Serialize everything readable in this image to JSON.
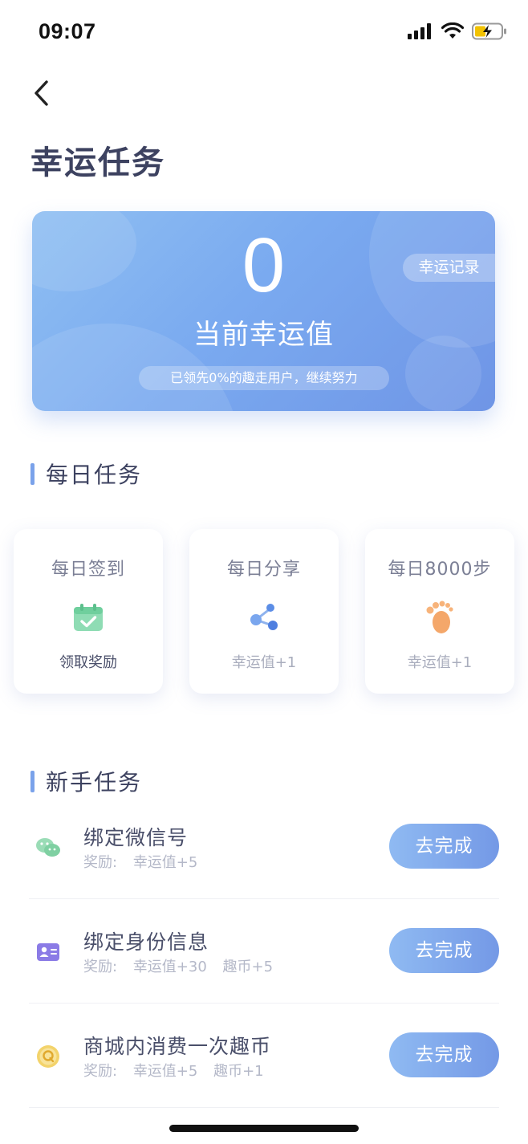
{
  "status_bar": {
    "time": "09:07"
  },
  "header": {
    "title": "幸运任务"
  },
  "luck_card": {
    "value": "0",
    "label": "当前幸运值",
    "record_button": "幸运记录",
    "rank_text": "已领先0%的趣走用户，继续努力"
  },
  "daily": {
    "title": "每日任务",
    "cards": [
      {
        "title": "每日签到",
        "reward": "领取奖励",
        "icon": "calendar-check-icon"
      },
      {
        "title": "每日分享",
        "reward": "幸运值+1",
        "icon": "share-icon"
      },
      {
        "title": "每日8000步",
        "reward": "幸运值+1",
        "icon": "footprint-icon"
      }
    ]
  },
  "newbie": {
    "title": "新手任务",
    "tasks": [
      {
        "title": "绑定微信号",
        "reward_label": "奖励:",
        "rewards": [
          "幸运值+5"
        ],
        "button": "去完成",
        "icon": "wechat-icon"
      },
      {
        "title": "绑定身份信息",
        "reward_label": "奖励:",
        "rewards": [
          "幸运值+30",
          "趣币+5"
        ],
        "button": "去完成",
        "icon": "id-card-icon"
      },
      {
        "title": "商城内消费一次趣币",
        "reward_label": "奖励:",
        "rewards": [
          "幸运值+5",
          "趣币+1"
        ],
        "button": "去完成",
        "icon": "coin-icon"
      }
    ]
  },
  "colors": {
    "accent": "#7aa2ea",
    "card_gradient_start": "#8fbff2",
    "card_gradient_end": "#6f95e6"
  }
}
